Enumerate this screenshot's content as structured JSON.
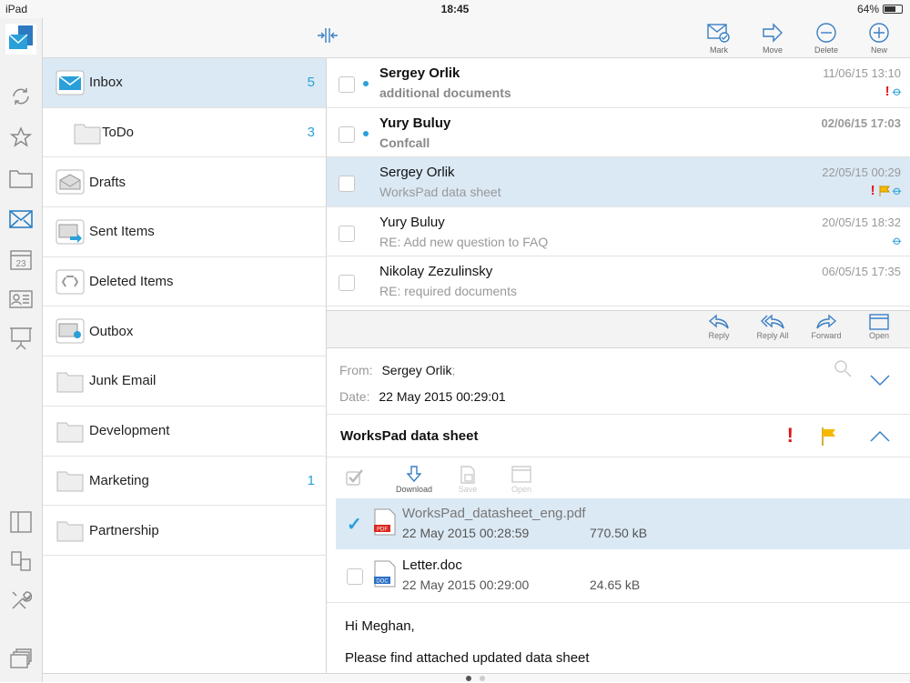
{
  "status": {
    "device": "iPad",
    "time": "18:45",
    "battery": "64%"
  },
  "toolbar": {
    "mark": "Mark",
    "move": "Move",
    "delete": "Delete",
    "new": "New"
  },
  "folders": [
    {
      "label": "Inbox",
      "count": "5",
      "icon": "mail-icon"
    },
    {
      "label": "ToDo",
      "count": "3",
      "icon": "folder-icon"
    },
    {
      "label": "Drafts",
      "count": "",
      "icon": "drafts-icon"
    },
    {
      "label": "Sent Items",
      "count": "",
      "icon": "sent-icon"
    },
    {
      "label": "Deleted Items",
      "count": "",
      "icon": "recycle-icon"
    },
    {
      "label": "Outbox",
      "count": "",
      "icon": "outbox-icon"
    },
    {
      "label": "Junk Email",
      "count": "",
      "icon": "folder-icon"
    },
    {
      "label": "Development",
      "count": "",
      "icon": "folder-icon"
    },
    {
      "label": "Marketing",
      "count": "1",
      "icon": "folder-icon"
    },
    {
      "label": "Partnership",
      "count": "",
      "icon": "folder-icon"
    }
  ],
  "messages": [
    {
      "from": "Sergey Orlik",
      "subject": "additional documents",
      "date": "11/06/15 13:10"
    },
    {
      "from": "Yury Buluy",
      "subject": "Confcall",
      "date": "02/06/15 17:03"
    },
    {
      "from": "Sergey Orlik",
      "subject": "WorksPad data sheet",
      "date": "22/05/15 00:29"
    },
    {
      "from": "Yury Buluy",
      "subject": "RE: Add new question to FAQ",
      "date": "20/05/15 18:32"
    },
    {
      "from": "Nikolay Zezulinsky",
      "subject": "RE: required documents",
      "date": "06/05/15 17:35"
    }
  ],
  "actions": {
    "reply": "Reply",
    "reply_all": "Reply All",
    "forward": "Forward",
    "open": "Open"
  },
  "reader": {
    "from_label": "From:",
    "from_value": "Sergey Orlik",
    "date_label": "Date:",
    "date_value": "22 May 2015 00:29:01",
    "subject": "WorksPad data sheet",
    "attach_toolbar": {
      "download": "Download",
      "save": "Save",
      "open": "Open"
    },
    "attachments": [
      {
        "name": "WorksPad_datasheet_eng.pdf",
        "date": "22 May 2015 00:28:59",
        "size": "770.50 kB",
        "type": "PDF"
      },
      {
        "name": "Letter.doc",
        "date": "22 May 2015 00:29:00",
        "size": "24.65 kB",
        "type": "DOC"
      }
    ],
    "body": [
      "Hi Meghan,",
      "Please find attached updated data sheet"
    ]
  },
  "colors": {
    "accent": "#2aa0da",
    "selection": "#dbe9f4",
    "important": "#e0161b",
    "flag": "#f5b800"
  }
}
